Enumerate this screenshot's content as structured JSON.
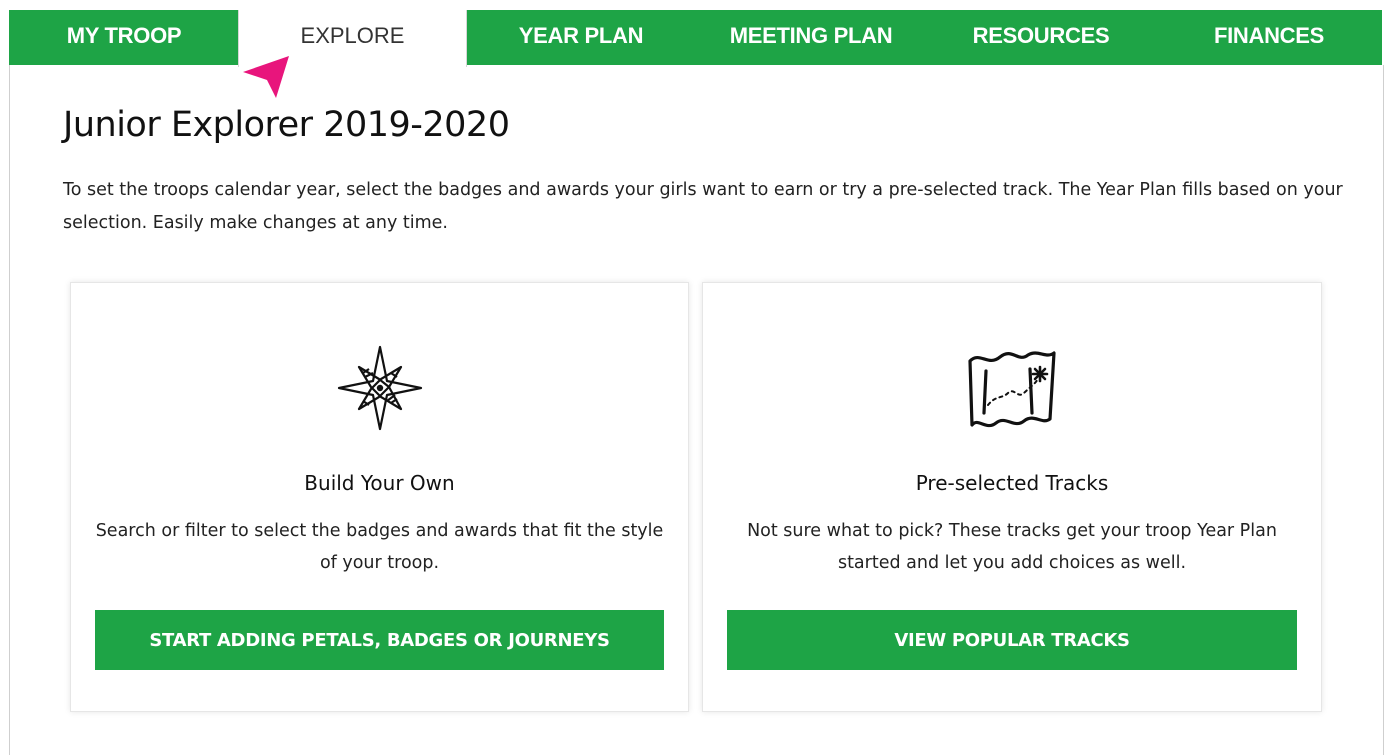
{
  "nav": {
    "tabs": [
      {
        "label": "MY TROOP"
      },
      {
        "label": "EXPLORE",
        "active": true
      },
      {
        "label": "YEAR PLAN"
      },
      {
        "label": "MEETING PLAN"
      },
      {
        "label": "RESOURCES"
      },
      {
        "label": "FINANCES"
      }
    ]
  },
  "page": {
    "title": "Junior Explorer 2019-2020",
    "intro": "To set the troops calendar year, select the badges and awards your girls want to earn or try a pre-selected track. The Year Plan fills based on your selection. Easily make changes at any time."
  },
  "cards": [
    {
      "icon": "compass-star-icon",
      "title": "Build Your Own",
      "description": "Search or filter to select the badges and awards that fit the style of your troop.",
      "button": "START ADDING PETALS, BADGES OR JOURNEYS"
    },
    {
      "icon": "treasure-map-icon",
      "title": "Pre-selected Tracks",
      "description": "Not sure what to pick? These tracks get your troop Year Plan started and let you add choices as well.",
      "button": "VIEW POPULAR TRACKS"
    }
  ],
  "colors": {
    "brand_green": "#1ea446",
    "pointer_pink": "#e8157c"
  }
}
